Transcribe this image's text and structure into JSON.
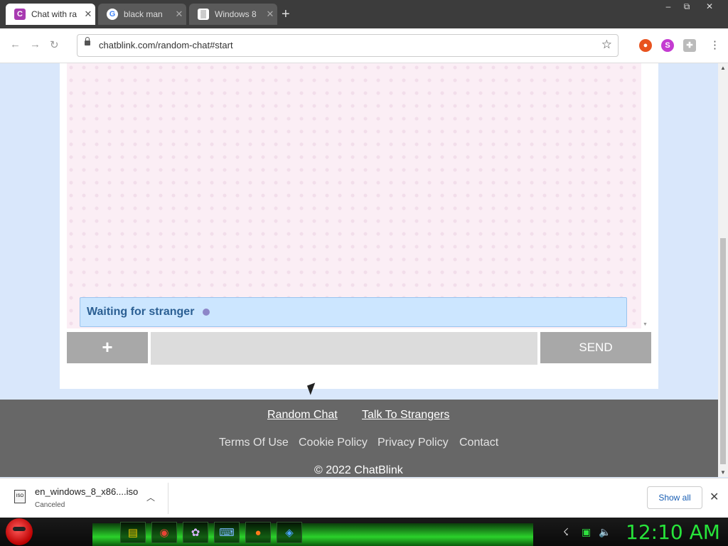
{
  "browser": {
    "tabs": [
      {
        "title": "Chat with ra",
        "favicon_letter": "C",
        "favicon_color": "#a83ab1",
        "active": true
      },
      {
        "title": "black man",
        "favicon_letter": "G",
        "favicon_color": "#4285f4",
        "active": false
      },
      {
        "title": "Windows 8",
        "favicon_letter": "▒",
        "favicon_color": "#333333",
        "active": false
      }
    ],
    "new_tab": "+",
    "window_controls": {
      "minimize": "–",
      "restore": "⧉",
      "close": "✕"
    },
    "url": "chatblink.com/random-chat#start"
  },
  "chat": {
    "status_text": "Waiting for stranger",
    "plus_label": "+",
    "send_label": "SEND",
    "message_value": ""
  },
  "footer": {
    "primary_links": [
      "Random Chat",
      "Talk To Strangers"
    ],
    "secondary_links": [
      "Terms Of Use",
      "Cookie Policy",
      "Privacy Policy",
      "Contact"
    ],
    "copyright": "© 2022 ChatBlink"
  },
  "download": {
    "filename": "en_windows_8_x86....iso",
    "status": "Canceled",
    "show_all": "Show all"
  },
  "taskbar": {
    "clock": "12:10 AM"
  },
  "colors": {
    "chat_bg": "#fbeef5",
    "waiting_bg": "#cce6ff",
    "footer_bg": "#676767",
    "clock_green": "#27e43a"
  }
}
